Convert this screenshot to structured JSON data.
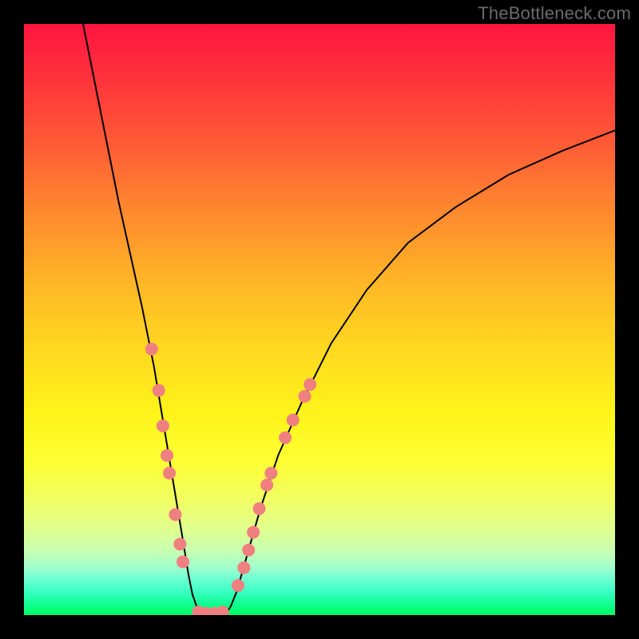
{
  "attribution": "TheBottleneck.com",
  "colors": {
    "frame": "#000000",
    "dot_fill": "#f08080",
    "curve_stroke": "#000000",
    "attribution_text": "#6b6b6b",
    "gradient_stops": [
      "#ff153f",
      "#ff2e3c",
      "#ff5a36",
      "#ff8a2e",
      "#ffb726",
      "#ffd820",
      "#fff41a",
      "#fdff33",
      "#f2ff5f",
      "#e2ff8a",
      "#c9ffb0",
      "#9fffce",
      "#6bffd2",
      "#3bffc3",
      "#12ff95",
      "#02ff5e"
    ]
  },
  "chart_data": {
    "type": "line",
    "title": "",
    "xlabel": "",
    "ylabel": "",
    "xlim": [
      0,
      100
    ],
    "ylim": [
      0,
      100
    ],
    "legend": "none",
    "grid": false,
    "description": "V-shaped bottleneck curve over vertical red→yellow→green gradient; dots cluster near bottom of V on both arms.",
    "series": [
      {
        "name": "left-arc",
        "kind": "curve",
        "x": [
          10,
          12,
          14,
          16,
          18,
          20,
          21,
          22,
          23,
          24,
          25,
          26,
          27,
          27.8,
          28.5,
          29.2,
          29.8,
          30
        ],
        "y": [
          100,
          90,
          80,
          70,
          61,
          52,
          47,
          42,
          36,
          30,
          24,
          18,
          12,
          7,
          3.5,
          1.5,
          0.5,
          0
        ]
      },
      {
        "name": "flat-bottom",
        "kind": "curve",
        "x": [
          30,
          31,
          32,
          33,
          34
        ],
        "y": [
          0,
          0,
          0,
          0,
          0
        ]
      },
      {
        "name": "right-arc",
        "kind": "curve",
        "x": [
          34,
          35,
          36,
          38,
          40,
          43,
          47,
          52,
          58,
          65,
          73,
          82,
          91,
          100
        ],
        "y": [
          0,
          1.5,
          4,
          11,
          18,
          27,
          36,
          46,
          55,
          63,
          69,
          74.5,
          78.5,
          82
        ]
      }
    ],
    "dots": [
      {
        "x": 21.6,
        "y": 45
      },
      {
        "x": 22.8,
        "y": 38
      },
      {
        "x": 23.5,
        "y": 32
      },
      {
        "x": 24.2,
        "y": 27
      },
      {
        "x": 24.6,
        "y": 24
      },
      {
        "x": 25.6,
        "y": 17
      },
      {
        "x": 26.4,
        "y": 12
      },
      {
        "x": 26.9,
        "y": 9
      },
      {
        "x": 29.5,
        "y": 0.5
      },
      {
        "x": 30.8,
        "y": 0.3
      },
      {
        "x": 32.2,
        "y": 0.3
      },
      {
        "x": 33.6,
        "y": 0.5
      },
      {
        "x": 36.2,
        "y": 5
      },
      {
        "x": 37.2,
        "y": 8
      },
      {
        "x": 38.0,
        "y": 11
      },
      {
        "x": 38.8,
        "y": 14
      },
      {
        "x": 39.8,
        "y": 18
      },
      {
        "x": 41.1,
        "y": 22
      },
      {
        "x": 41.8,
        "y": 24
      },
      {
        "x": 44.2,
        "y": 30
      },
      {
        "x": 45.5,
        "y": 33
      },
      {
        "x": 47.5,
        "y": 37
      },
      {
        "x": 48.4,
        "y": 39
      }
    ]
  }
}
